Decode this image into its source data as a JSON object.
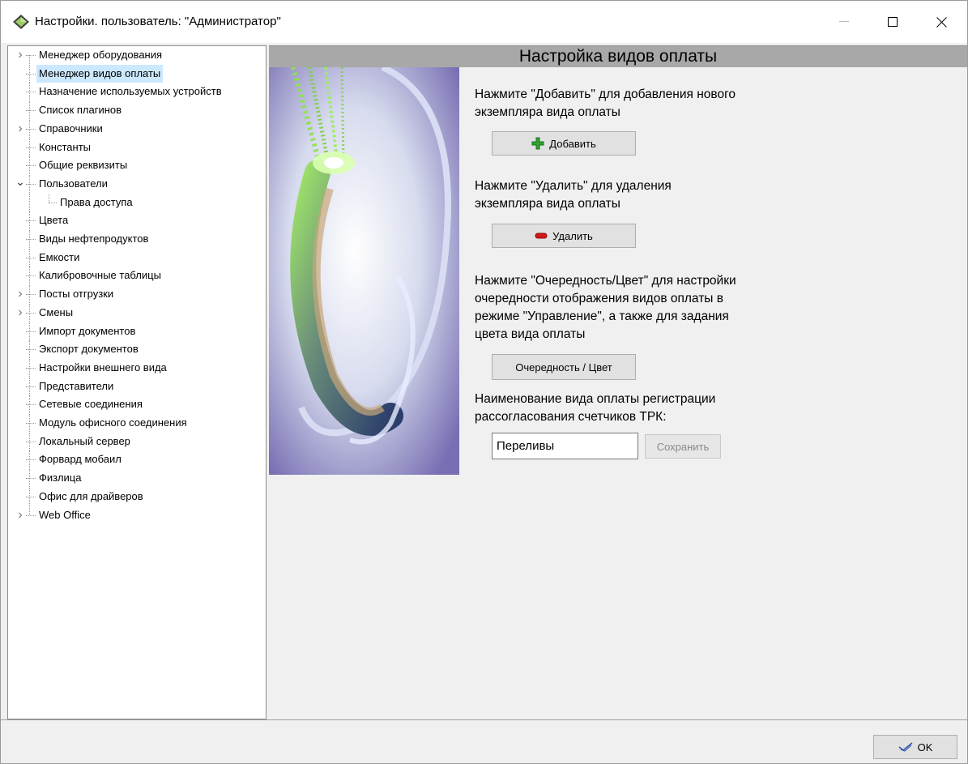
{
  "window": {
    "title": "Настройки. пользователь: \"Администратор\""
  },
  "tree": {
    "items": [
      {
        "label": "Менеджер оборудования",
        "expandable": true
      },
      {
        "label": "Менеджер видов оплаты",
        "selected": true
      },
      {
        "label": "Назначение используемых устройств"
      },
      {
        "label": "Список плагинов"
      },
      {
        "label": "Справочники",
        "expandable": true
      },
      {
        "label": "Константы"
      },
      {
        "label": "Общие реквизиты"
      },
      {
        "label": "Пользователи",
        "expanded": true
      },
      {
        "label": "Права доступа",
        "child": true
      },
      {
        "label": "Цвета"
      },
      {
        "label": "Виды нефтепродуктов"
      },
      {
        "label": "Емкости"
      },
      {
        "label": "Калибровочные таблицы"
      },
      {
        "label": "Посты отгрузки",
        "expandable": true
      },
      {
        "label": "Смены",
        "expandable": true
      },
      {
        "label": "Импорт документов"
      },
      {
        "label": "Экспорт документов"
      },
      {
        "label": "Настройки внешнего вида"
      },
      {
        "label": "Представители"
      },
      {
        "label": "Сетевые соединения"
      },
      {
        "label": "Модуль офисного соединения"
      },
      {
        "label": "Локальный сервер"
      },
      {
        "label": "Форвард мобаил"
      },
      {
        "label": "Физлица"
      },
      {
        "label": "Офис для драйверов"
      },
      {
        "label": "Web Office",
        "expandable": true
      }
    ]
  },
  "content": {
    "header": "Настройка видов оплаты",
    "add_text_1": "Нажмите \"Добавить\" для добавления нового",
    "add_text_2": "экземпляра вида оплаты",
    "add_button": "Добавить",
    "delete_text_1": "Нажмите \"Удалить\" для удаления",
    "delete_text_2": "экземпляра вида оплаты",
    "delete_button": "Удалить",
    "order_text_1": "Нажмите \"Очередность/Цвет\" для настройки",
    "order_text_2": "очередности отображения видов оплаты в",
    "order_text_3": "режиме \"Управление\", а также для задания",
    "order_text_4": "цвета вида оплаты",
    "order_button": "Очередность / Цвет",
    "name_text_1": "Наименование вида оплаты регистрации",
    "name_text_2": "рассогласования счетчиков ТРК:",
    "name_value": "Переливы",
    "save_button": "Сохранить"
  },
  "footer": {
    "ok_button": "OK"
  },
  "colors": {
    "selection": "#cce8ff",
    "header_bg": "#a8a8a8",
    "add_icon": "#2fa52f",
    "delete_icon": "#d11a1a"
  }
}
